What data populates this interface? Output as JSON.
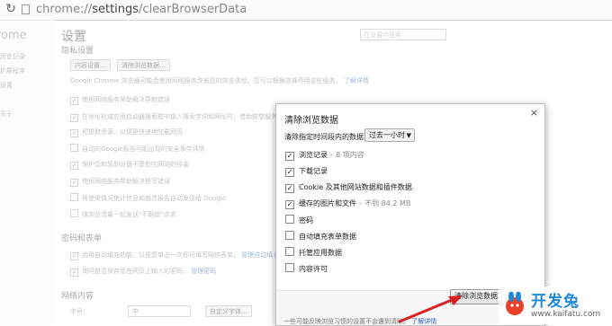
{
  "url": {
    "prefix": "chrome://",
    "bold": "settings",
    "path": "/clearBrowserData"
  },
  "sidebar": {
    "brand": "rome",
    "items": [
      "历史记录",
      "扩展程序",
      "设置",
      "关于"
    ]
  },
  "settings": {
    "title": "设置",
    "search_placeholder": "在设置中搜索",
    "privacy": {
      "heading": "隐私设置",
      "buttons": [
        "内容设置...",
        "清除浏览数据..."
      ],
      "desc": "Google Chrome 浏览器可能会使用网络服务改善您的浏览体验。您可以根据选择停用这些服务。",
      "learn_more": "了解详情",
      "rows": [
        {
          "checked": true,
          "text": "使用网络服务帮助解决导航错误"
        },
        {
          "checked": true,
          "text": "在地址栏或应用启动器搜索框中输入搜索字词和网址时，借助联想服务"
        },
        {
          "checked": true,
          "text": "预提取资源，以便更快速地加载网页"
        },
        {
          "checked": false,
          "text": "自动向Google报告可能出现的安全事件详情"
        },
        {
          "checked": true,
          "text": "保护您和您的设备不受危险网站的侵害"
        },
        {
          "checked": true,
          "text": "使用网络服务帮助解决拼写错误"
        },
        {
          "checked": false,
          "text": "将使用情况统计信息和崩溃报告自动发送给 Google"
        },
        {
          "checked": false,
          "text": "随浏览流量一起发送\"不跟踪\"请求"
        }
      ]
    },
    "passwords": {
      "heading": "密码和表单",
      "rows": [
        {
          "checked": true,
          "text": "启用自动填充功能，以便您单击一次即可填写网络表单。",
          "link": "管理自动填充设置"
        },
        {
          "checked": true,
          "text": "询问是否保存您在网页上输入的密码。",
          "link": "管理密码"
        }
      ]
    },
    "web_content": {
      "heading": "网络内容",
      "font_label": "字号：",
      "font_value": "中",
      "custom_button": "自定义字体..."
    }
  },
  "dialog": {
    "title": "清除浏览数据",
    "close": "×",
    "range_label": "清除指定时间段内的数据：",
    "range_value": "过去一小时",
    "options": [
      {
        "checked": true,
        "label": "浏览记录",
        "detail": " – 8 项内容"
      },
      {
        "checked": true,
        "label": "下载记录",
        "detail": ""
      },
      {
        "checked": true,
        "label": "Cookie 及其他网站数据和插件数据",
        "detail": ""
      },
      {
        "checked": true,
        "label": "缓存的图片和文件",
        "detail": " – 不到 84.2 MB"
      },
      {
        "checked": false,
        "label": "密码",
        "detail": ""
      },
      {
        "checked": false,
        "label": "自动填充表单数据",
        "detail": ""
      },
      {
        "checked": false,
        "label": "托管应用数据",
        "detail": ""
      },
      {
        "checked": false,
        "label": "内容许可",
        "detail": ""
      }
    ],
    "clear_button": "清除浏览数据",
    "note": "一些可能反映浏览习惯的设置不会遭到清除。",
    "note_link": "了解详情"
  },
  "watermark": {
    "text": "开发兔",
    "url": "www.kaifatu.com"
  },
  "colors": {
    "link": "#3366cc",
    "annotation_arrow": "#d9201f",
    "watermark": "#1e88d8"
  }
}
